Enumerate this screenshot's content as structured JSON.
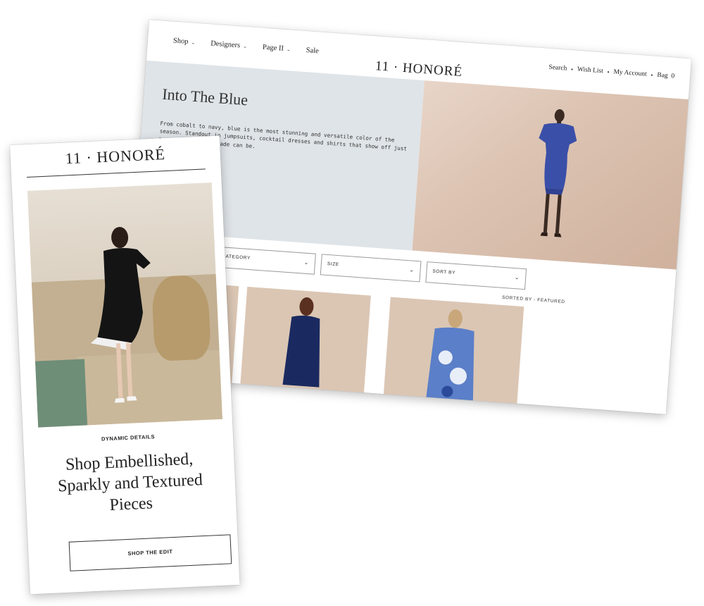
{
  "desktop": {
    "nav": {
      "items": [
        {
          "label": "Shop"
        },
        {
          "label": "Designers"
        },
        {
          "label": "Page II"
        },
        {
          "label": "Sale"
        }
      ],
      "logo": "11 · HONORÉ",
      "right": {
        "search": "Search",
        "wishlist": "Wish List",
        "account": "My Account",
        "bag": "Bag",
        "bag_count": "0"
      }
    },
    "hero": {
      "title": "Into The Blue",
      "text": "From cobalt to navy, blue is the most stunning and versatile color of the season. Standout in jumpsuits, cocktail dresses and shirts that show off just how gorgeous the shade can be."
    },
    "filters": {
      "category_label": "CATEGORY",
      "size_label": "SIZE",
      "sort_label": "SORT BY",
      "sorted_by": "SORTED BY - FEATURED"
    }
  },
  "mobile": {
    "logo": "11 · HONORÉ",
    "eyebrow": "DYNAMIC DETAILS",
    "heading": "Shop Embellished, Sparkly and Textured Pieces",
    "button": "SHOP THE EDIT"
  },
  "colors": {
    "hero_panel": "#dfe4e8",
    "photo_beige": "#dbc6b4",
    "dress_blue": "#3a4fa8"
  }
}
